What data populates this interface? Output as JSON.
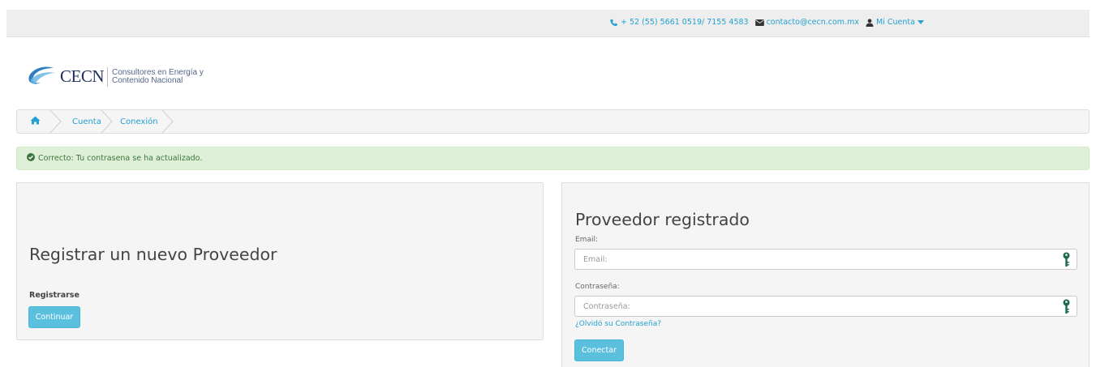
{
  "topbar": {
    "phone": "+ 52 (55) 5661 0519/ 7155 4583",
    "email": "contacto@cecn.com.mx",
    "account": "Mi Cuenta"
  },
  "logo": {
    "name": "CECN",
    "tagline_line1": "Consultores en Energía y",
    "tagline_line2": "Contenido Nacional"
  },
  "breadcrumb": {
    "items": [
      "Cuenta",
      "Conexión"
    ]
  },
  "alert": {
    "message": "Correcto: Tu contrasena se ha actualizado."
  },
  "register": {
    "title": "Registrar un nuevo Proveedor",
    "subtitle": "Registrarse",
    "button": "Continuar"
  },
  "login": {
    "title": "Proveedor registrado",
    "email_label": "Email:",
    "email_placeholder": "Email:",
    "password_label": "Contraseña:",
    "password_placeholder": "Contraseña:",
    "forgot": "¿Olvidó su Contraseña?",
    "button": "Conectar"
  },
  "colors": {
    "link": "#23a1d1",
    "button": "#5bc0de",
    "alert_bg": "#dff0d8",
    "alert_text": "#3c763d",
    "key_icon": "#1a6b4a"
  }
}
